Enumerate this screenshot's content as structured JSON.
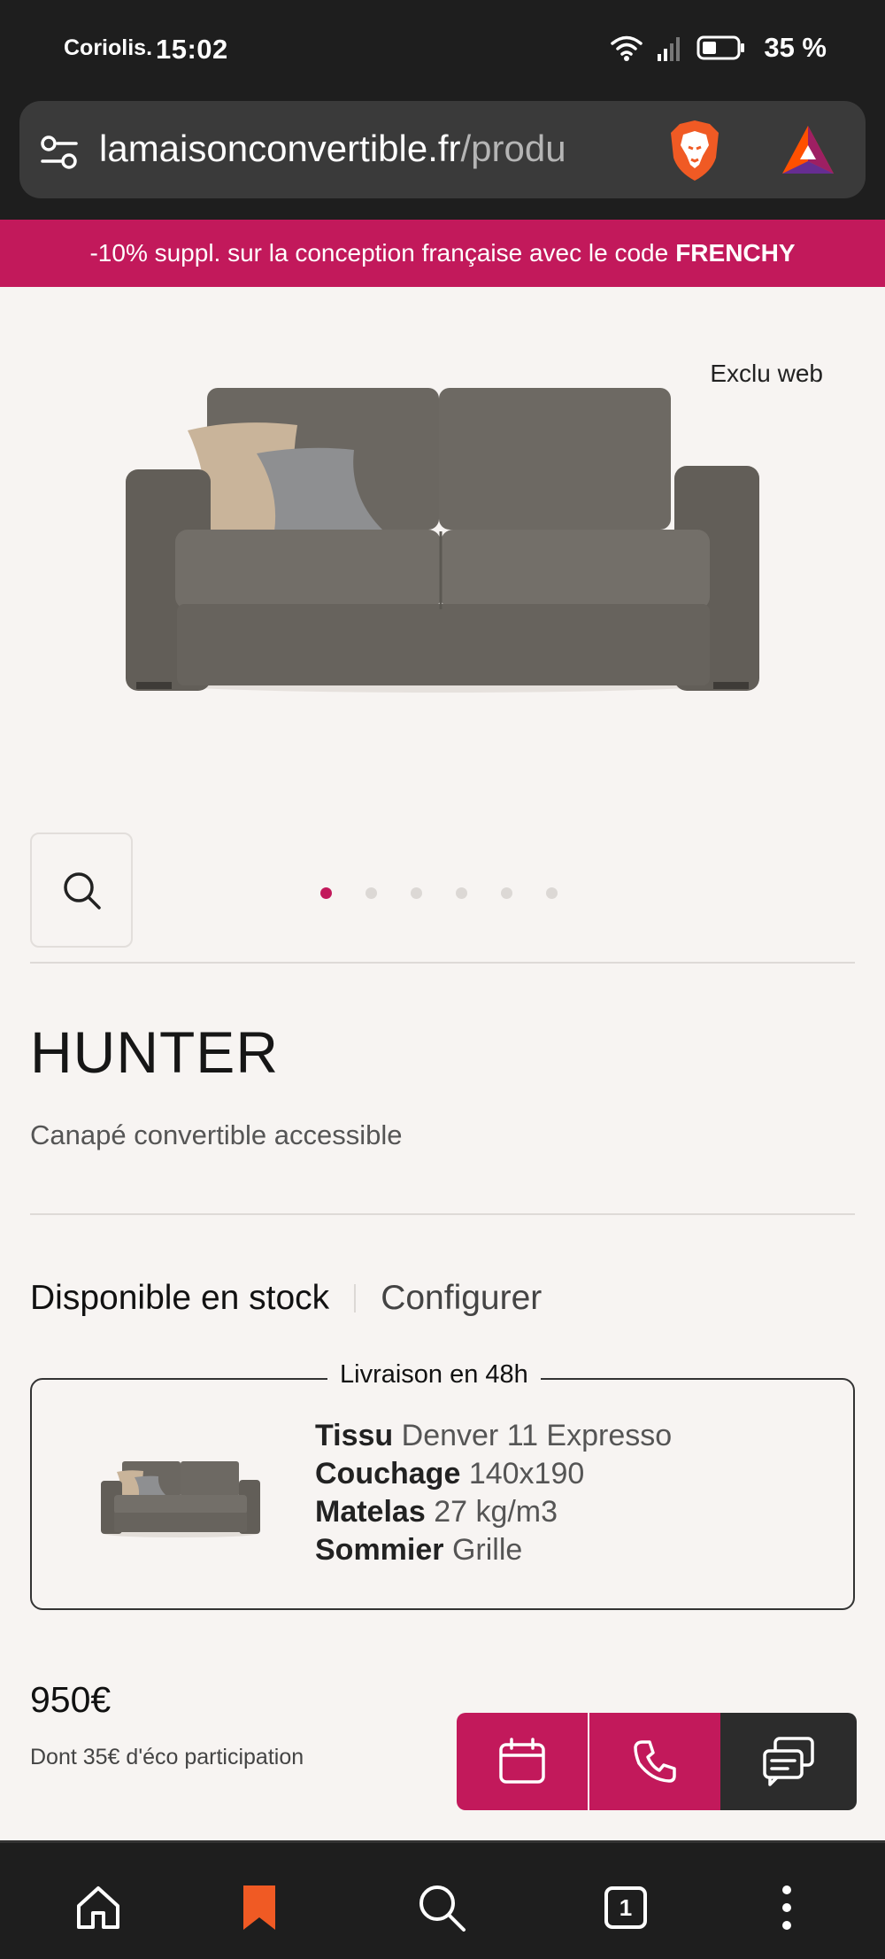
{
  "status_bar": {
    "carrier": "Coriolis.",
    "time": "15:02",
    "battery": "35 %"
  },
  "browser": {
    "url_domain": "lamaisonconvertible.fr",
    "url_path": "/produ",
    "open_tabs": "1"
  },
  "promo": {
    "text": "-10% suppl. sur la conception française avec le code",
    "code": "FRENCHY"
  },
  "product": {
    "badge": "Exclu web",
    "name": "HUNTER",
    "subtitle": "Canapé convertible accessible",
    "gallery_dots": 6,
    "active_dot": 1
  },
  "tabs": {
    "in_stock": "Disponible en stock",
    "configure": "Configurer"
  },
  "stock_card": {
    "legend": "Livraison en 48h",
    "specs": [
      {
        "key": "Tissu",
        "value": "Denver 11 Expresso"
      },
      {
        "key": "Couchage",
        "value": "140x190"
      },
      {
        "key": "Matelas",
        "value": "27 kg/m3"
      },
      {
        "key": "Sommier",
        "value": "Grille"
      }
    ]
  },
  "price": {
    "amount": "950€",
    "eco_note": "Dont 35€ d'éco participation"
  },
  "colors": {
    "brand": "#c2195b",
    "dark": "#1e1e1e",
    "background": "#f7f4f2"
  },
  "icons": [
    "search-icon",
    "calendar-icon",
    "phone-icon",
    "chat-icon",
    "home-icon",
    "bookmark-icon",
    "tabs-icon",
    "menu-icon"
  ]
}
